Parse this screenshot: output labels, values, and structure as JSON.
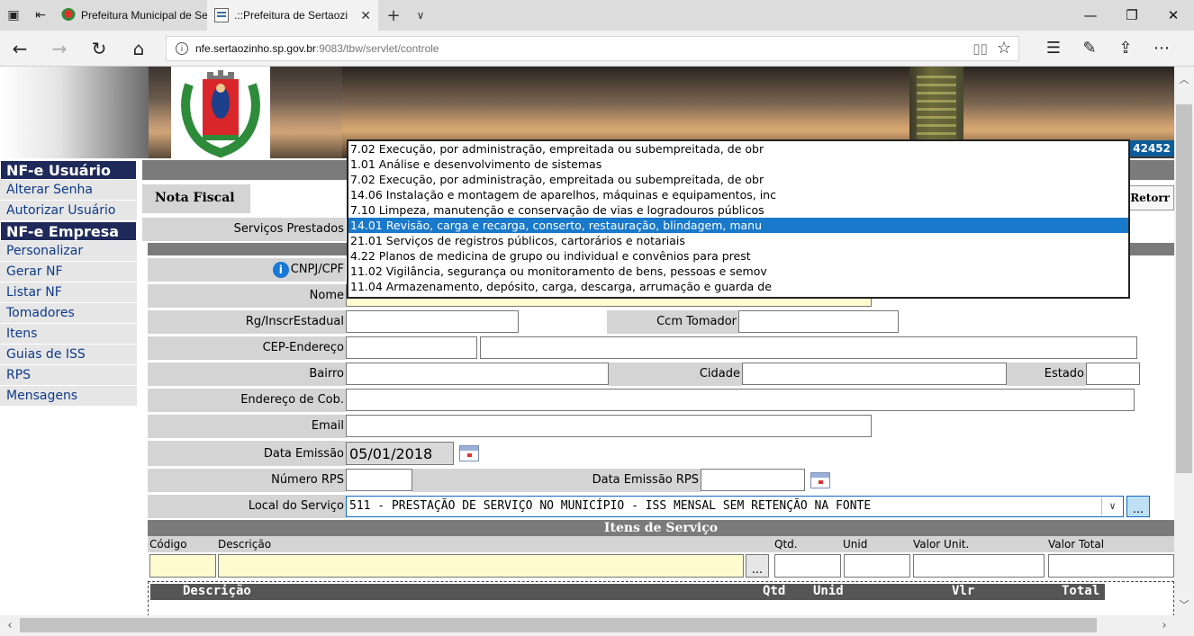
{
  "browser": {
    "tabs": [
      {
        "title": "Prefeitura Municipal de Sert",
        "active": false
      },
      {
        "title": ".::Prefeitura de Sertaozi",
        "active": true
      }
    ],
    "new_tab": "+",
    "tab_list": "∨",
    "url_host": "nfe.sertaozinho.sp.gov.br",
    "url_path": ":9083/tbw/servlet/controle"
  },
  "banner": {
    "code": "42452"
  },
  "sidebar": {
    "usuario_title": "NF-e Usuário",
    "usuario_items": [
      "Alterar Senha",
      "Autorizar Usuário"
    ],
    "empresa_title": "NF-e Empresa",
    "empresa_items": [
      "Personalizar",
      "Gerar NF",
      "Listar NF",
      "Tomadores",
      "Itens",
      "Guias de ISS",
      "RPS",
      "Mensagens"
    ]
  },
  "form": {
    "tab_label": "Nota Fiscal",
    "retornar_label": "Retorr",
    "servicos_label": "Serviços Prestados",
    "cnpj_label": "CNPJ/CPF",
    "nome_label": "Nome",
    "rg_label": "Rg/InscrEstadual",
    "ccm_label": "Ccm Tomador",
    "cep_label": "CEP-Endereço",
    "bairro_label": "Bairro",
    "cidade_label": "Cidade",
    "estado_label": "Estado",
    "endcob_label": "Endereço de Cob.",
    "email_label": "Email",
    "data_emissao_label": "Data Emissão",
    "data_emissao_value": "05/01/2018",
    "numero_rps_label": "Número RPS",
    "data_emissao_rps_label": "Data Emissão RPS",
    "local_servico_label": "Local do Serviço",
    "local_servico_value": "511 - PRESTAÇÃO DE SERVIÇO NO MUNICÍPIO - ISS MENSAL SEM RETENÇÃO NA FONTE",
    "ellipsis": "..."
  },
  "itens": {
    "section_title": "Itens de Serviço",
    "columns": [
      "Código",
      "Descrição",
      "Qtd.",
      "Unid",
      "Valor Unit.",
      "Valor Total"
    ],
    "list_columns": [
      "Descrição",
      "Qtd",
      "Unid",
      "Vlr",
      "Total"
    ]
  },
  "dropdown": {
    "options": [
      "7.02 Execução, por administração, empreitada ou subempreitada, de obr",
      "1.01 Análise e desenvolvimento de sistemas",
      "7.02 Execução, por administração, empreitada ou subempreitada, de obr",
      "14.06 Instalação e montagem de aparelhos, máquinas e equipamentos, inc",
      "7.10 Limpeza, manutenção e conservação de vias e logradouros públicos",
      "14.01 Revisão, carga e recarga, conserto, restauração, blindagem, manu",
      "21.01 Serviços de registros públicos, cartorários e notariais",
      "4.22 Planos de medicina de grupo ou individual e convênios para prest",
      "11.02 Vigilância, segurança ou monitoramento de bens, pessoas e semov",
      "11.04 Armazenamento, depósito, carga, descarga, arrumação e guarda de"
    ],
    "selected_index": 5
  }
}
